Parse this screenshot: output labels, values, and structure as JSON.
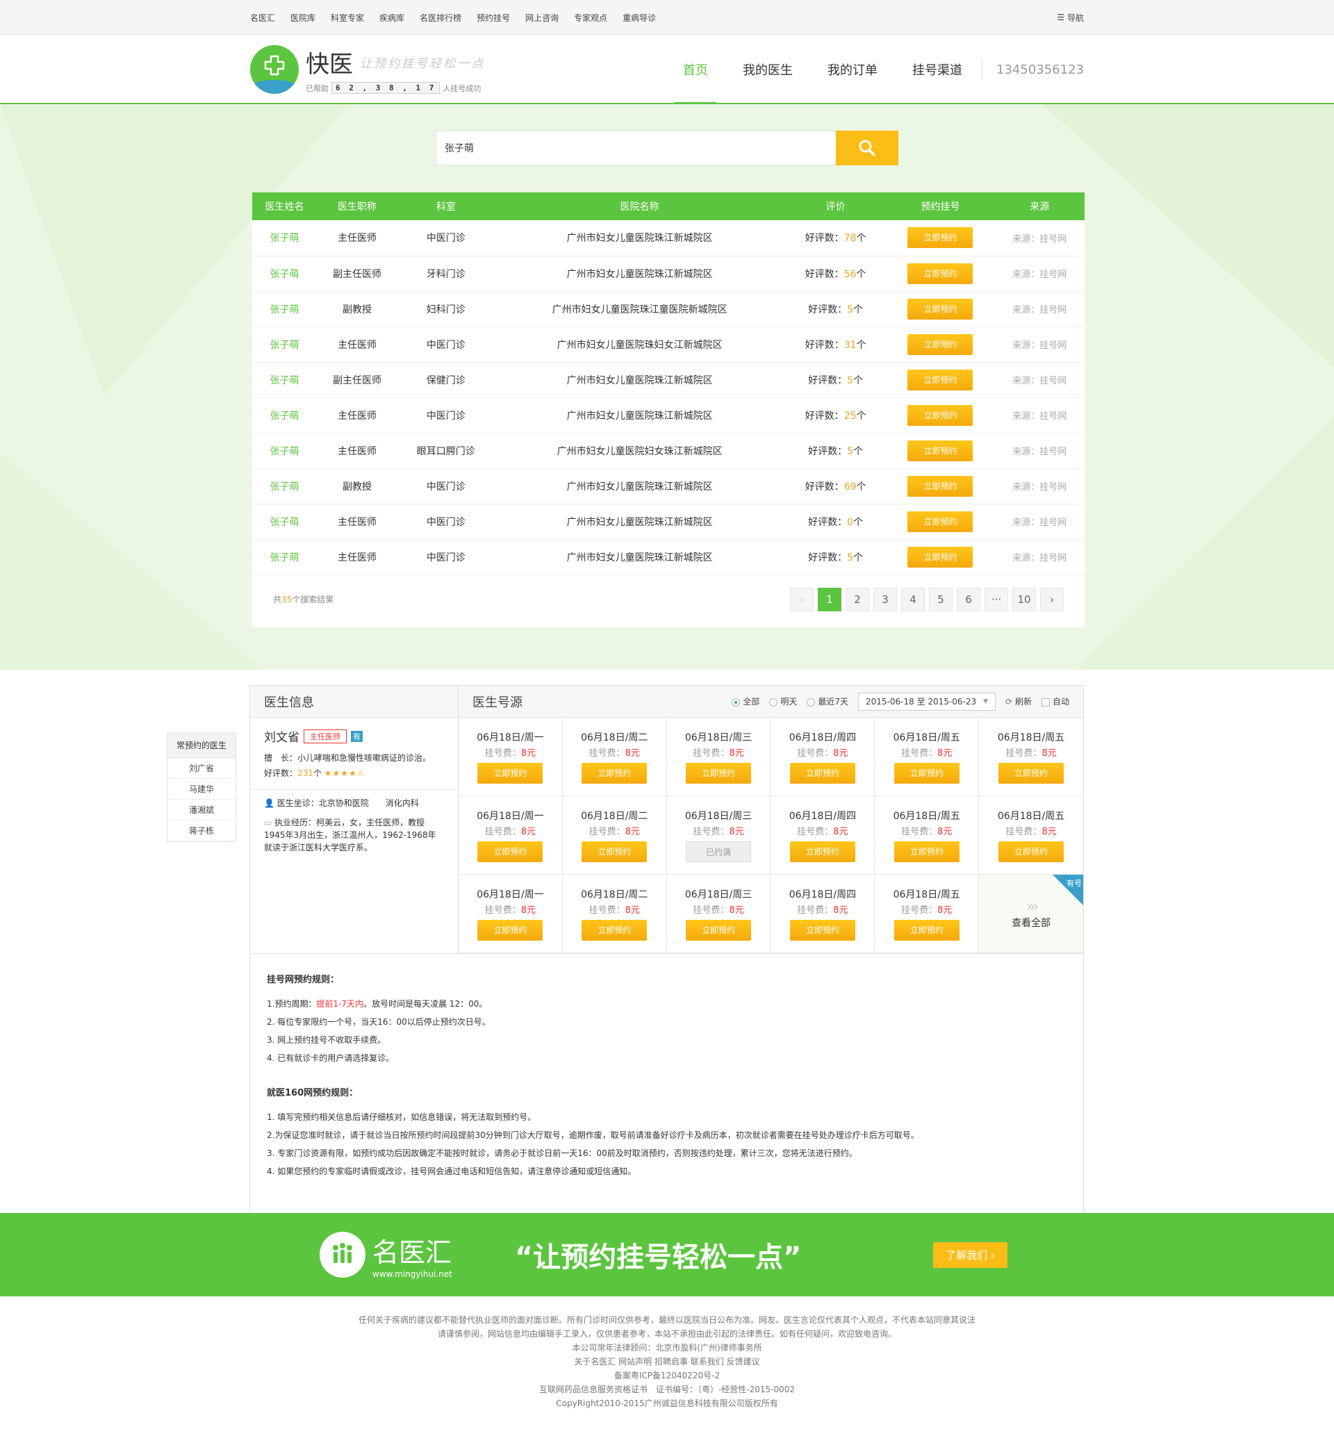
{
  "topnav": [
    "名医汇",
    "医院库",
    "科室专家",
    "疾病库",
    "名医排行榜",
    "预约挂号",
    "网上咨询",
    "专家观点",
    "重病导诊"
  ],
  "topnav_menu": "导航",
  "brand": {
    "name": "快医",
    "slogan": "让预约挂号轻松一点",
    "help_prefix": "已帮助",
    "counter": "6 2 , 3 8 , 1 7",
    "help_suffix": "人挂号成功"
  },
  "mainnav": {
    "home": "首页",
    "doctors": "我的医生",
    "orders": "我的订单",
    "channel": "挂号渠道",
    "phone": "13450356123"
  },
  "search": {
    "value": "张子萌"
  },
  "table": {
    "headers": [
      "医生姓名",
      "医生职称",
      "科室",
      "医院名称",
      "评价",
      "预约挂号",
      "来源"
    ],
    "rows": [
      {
        "name": "张子萌",
        "title": "主任医师",
        "dept": "中医门诊",
        "hospital": "广州市妇女儿童医院珠江新城院区",
        "rate_label": "好评数：",
        "rate": "78",
        "unit": "个",
        "btn": "立即预约",
        "src": "来源：挂号网"
      },
      {
        "name": "张子萌",
        "title": "副主任医师",
        "dept": "牙科门诊",
        "hospital": "广州市妇女儿童医院珠江新城院区",
        "rate_label": "好评数：",
        "rate": "56",
        "unit": "个",
        "btn": "立即预约",
        "src": "来源：挂号网"
      },
      {
        "name": "张子萌",
        "title": "副教授",
        "dept": "妇科门诊",
        "hospital": "广州市妇女儿童医院珠江童医院新城院区",
        "rate_label": "好评数：",
        "rate": "5",
        "unit": "个",
        "btn": "立即预约",
        "src": "来源：挂号网"
      },
      {
        "name": "张子萌",
        "title": "主任医师",
        "dept": "中医门诊",
        "hospital": "广州市妇女儿童医院珠妇女江新城院区",
        "rate_label": "好评数：",
        "rate": "31",
        "unit": "个",
        "btn": "立即预约",
        "src": "来源：挂号网"
      },
      {
        "name": "张子萌",
        "title": "副主任医师",
        "dept": "保健门诊",
        "hospital": "广州市妇女儿童医院珠江新城院区",
        "rate_label": "好评数：",
        "rate": "5",
        "unit": "个",
        "btn": "立即预约",
        "src": "来源：挂号网"
      },
      {
        "name": "张子萌",
        "title": "主任医师",
        "dept": "中医门诊",
        "hospital": "广州市妇女儿童医院珠江新城院区",
        "rate_label": "好评数：",
        "rate": "25",
        "unit": "个",
        "btn": "立即预约",
        "src": "来源：挂号网"
      },
      {
        "name": "张子萌",
        "title": "主任医师",
        "dept": "眼耳口腭门诊",
        "hospital": "广州市妇女儿童医院妇女珠江新城院区",
        "rate_label": "好评数：",
        "rate": "5",
        "unit": "个",
        "btn": "立即预约",
        "src": "来源：挂号网"
      },
      {
        "name": "张子萌",
        "title": "副教授",
        "dept": "中医门诊",
        "hospital": "广州市妇女儿童医院珠江新城院区",
        "rate_label": "好评数：",
        "rate": "69",
        "unit": "个",
        "btn": "立即预约",
        "src": "来源：挂号网"
      },
      {
        "name": "张子萌",
        "title": "主任医师",
        "dept": "中医门诊",
        "hospital": "广州市妇女儿童医院珠江新城院区",
        "rate_label": "好评数：",
        "rate": "0",
        "unit": "个",
        "btn": "立即预约",
        "src": "来源：挂号网"
      },
      {
        "name": "张子萌",
        "title": "主任医师",
        "dept": "中医门诊",
        "hospital": "广州市妇女儿童医院珠江新城院区",
        "rate_label": "好评数：",
        "rate": "5",
        "unit": "个",
        "btn": "立即预约",
        "src": "来源：挂号网"
      }
    ],
    "total_prefix": "共",
    "total": "35",
    "total_suffix": "个搜索结果",
    "pages": [
      "1",
      "2",
      "3",
      "4",
      "5",
      "6",
      "···",
      "10"
    ]
  },
  "favorites": {
    "title": "常预约的医生",
    "items": [
      "刘广省",
      "马建华",
      "潘湘斌",
      "蒋子栋"
    ]
  },
  "panel": {
    "left_title": "医生信息",
    "right_title": "医生号源",
    "opt_all": "全部",
    "opt_tomorrow": "明天",
    "opt_7days": "最近7天",
    "daterange": "2015-06-18 至 2015-06-23",
    "refresh": "刷新",
    "auto": "自动"
  },
  "doctor": {
    "name": "刘文省",
    "title": "主任医师",
    "you": "有",
    "skill": "擅　长：小儿哮喘和急慢性咳嗽病证的诊治。",
    "rate_label": "好评数：",
    "rate": "231",
    "rate_unit": "个",
    "stars": "★★★★☆",
    "clinic": "医生坐诊：北京协和医院　　消化内科",
    "exp": "执业经历：柯美云，女，主任医师，教授1945年3月出生，浙江温州人，1962-1968年就读于浙江医科大学医疗系。"
  },
  "slots": {
    "row1": [
      {
        "d": "06月18日/周一",
        "fee": "8元",
        "btn": "立即预约"
      },
      {
        "d": "06月18日/周二",
        "fee": "8元",
        "btn": "立即预约"
      },
      {
        "d": "06月18日/周三",
        "fee": "8元",
        "btn": "立即预约"
      },
      {
        "d": "06月18日/周四",
        "fee": "8元",
        "btn": "立即预约"
      },
      {
        "d": "06月18日/周五",
        "fee": "8元",
        "btn": "立即预约"
      },
      {
        "d": "06月18日/周五",
        "fee": "8元",
        "btn": "立即预约"
      }
    ],
    "row2": [
      {
        "d": "06月18日/周一",
        "fee": "8元",
        "btn": "立即预约"
      },
      {
        "d": "06月18日/周二",
        "fee": "8元",
        "btn": "立即预约"
      },
      {
        "d": "06月18日/周三",
        "fee": "8元",
        "btn": "已约满"
      },
      {
        "d": "06月18日/周四",
        "fee": "8元",
        "btn": "立即预约"
      },
      {
        "d": "06月18日/周五",
        "fee": "8元",
        "btn": "立即预约"
      },
      {
        "d": "06月18日/周五",
        "fee": "8元",
        "btn": "立即预约"
      }
    ],
    "row3": [
      {
        "d": "06月18日/周一",
        "fee": "8元",
        "btn": "立即预约"
      },
      {
        "d": "06月18日/周二",
        "fee": "8元",
        "btn": "立即预约"
      },
      {
        "d": "06月18日/周三",
        "fee": "8元",
        "btn": "立即预约"
      },
      {
        "d": "06月18日/周四",
        "fee": "8元",
        "btn": "立即预约"
      },
      {
        "d": "06月18日/周五",
        "fee": "8元",
        "btn": "立即预约"
      }
    ],
    "fee_label": "挂号费：",
    "view_all": "查看全部",
    "view_all_badge": "有号"
  },
  "rules": {
    "title1": "挂号网预约规则：",
    "r1_prefix": "1.预约周期：",
    "r1_red": "提前1-7天内",
    "r1_suffix": "。放号时间是每天凌晨 12：00。",
    "r2": "2. 每位专家限约一个号，当天16：00以后停止预约次日号。",
    "r3": "3. 网上预约挂号不收取手续费。",
    "r4": "4. 已有就诊卡的用户请选择复诊。",
    "title2": "就医160网预约规则：",
    "s1": "1. 填写完预约相关信息后请仔细核对，如信息错误，将无法取到预约号。",
    "s2": "2.为保证您准时就诊，请于就诊当日按所预约时间段提前30分钟到门诊大厅取号，逾期作废，取号前请准备好诊疗卡及病历本，初次就诊者需要在挂号处办理诊疗卡后方可取号。",
    "s3": "3. 专家门诊资源有限，如预约成功后因故确定不能按时就诊，请务必于就诊日前一天16：00前及时取消预约，否则按违约处理，累计三次，您将无法进行预约。",
    "s4": "4. 如果您预约的专家临时请假或改诊，挂号网会通过电话和短信告知，请注意停诊通知或短信通知。"
  },
  "banner": {
    "name": "名医汇",
    "url": "www.mingyihui.net",
    "slogan": "“让预约挂号轻松一点”",
    "btn": "了解我们"
  },
  "footer": [
    "任何关于疾病的建议都不能替代执业医师的面对面诊断。所有门诊时间仅供参考，最终以医院当日公布为准。网友、医生言论仅代表其个人观点，不代表本站同意其说法",
    "请谨慎参阅，网站信息均由编辑手工录入，仅供患者参考，本站不承担由此引起的法律责任。如有任何疑问，欢迎致电咨询。",
    "本公司常年法律顾问：北京市盈科(广州)律师事务所",
    "关于名医汇  网站声明  招聘启事  联系我们  反馈建议",
    "备案粤ICP备12040220号-2",
    "互联网药品信息服务资格证书　证书编号：（粤）-经营性-2015-0002",
    "CopyRight2010-2015广州诚益信息科技有限公司版权所有"
  ]
}
